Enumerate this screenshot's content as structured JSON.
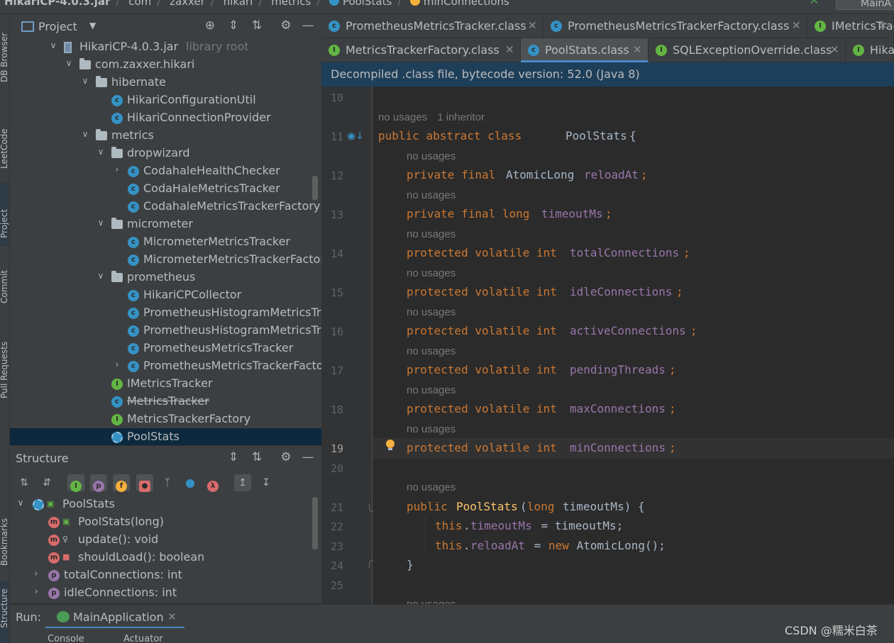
{
  "breadcrumb": [
    "HikariCP-4.0.3.jar",
    "com",
    "zaxxer",
    "hikari",
    "metrics",
    "PoolStats",
    "minConnections"
  ],
  "run_config": "MainA",
  "left_stripe": [
    "DB Browser",
    "LeetCode",
    "Project",
    "Commit",
    "Pull Requests",
    "Bookmarks",
    "Structure"
  ],
  "project": {
    "title": "Project",
    "tree": [
      {
        "label": "HikariCP-4.0.3.jar",
        "muted": "library root",
        "depth": 0,
        "arrow": "down",
        "icon": "jar"
      },
      {
        "label": "com.zaxxer.hikari",
        "depth": 1,
        "arrow": "down",
        "icon": "folder"
      },
      {
        "label": "hibernate",
        "depth": 2,
        "arrow": "down",
        "icon": "folder"
      },
      {
        "label": "HikariConfigurationUtil",
        "depth": 3,
        "arrow": "",
        "icon": "class"
      },
      {
        "label": "HikariConnectionProvider",
        "depth": 3,
        "arrow": "",
        "icon": "class"
      },
      {
        "label": "metrics",
        "depth": 2,
        "arrow": "down",
        "icon": "folder"
      },
      {
        "label": "dropwizard",
        "depth": 3,
        "arrow": "down",
        "icon": "folder"
      },
      {
        "label": "CodahaleHealthChecker",
        "depth": 4,
        "arrow": "right",
        "icon": "class"
      },
      {
        "label": "CodaHaleMetricsTracker",
        "depth": 4,
        "arrow": "",
        "icon": "class"
      },
      {
        "label": "CodahaleMetricsTrackerFactory",
        "depth": 4,
        "arrow": "",
        "icon": "class"
      },
      {
        "label": "micrometer",
        "depth": 3,
        "arrow": "down",
        "icon": "folder"
      },
      {
        "label": "MicrometerMetricsTracker",
        "depth": 4,
        "arrow": "",
        "icon": "class"
      },
      {
        "label": "MicrometerMetricsTrackerFactor",
        "depth": 4,
        "arrow": "",
        "icon": "class"
      },
      {
        "label": "prometheus",
        "depth": 3,
        "arrow": "down",
        "icon": "folder"
      },
      {
        "label": "HikariCPCollector",
        "depth": 4,
        "arrow": "",
        "icon": "class"
      },
      {
        "label": "PrometheusHistogramMetricsTra",
        "depth": 4,
        "arrow": "",
        "icon": "class"
      },
      {
        "label": "PrometheusHistogramMetricsTra",
        "depth": 4,
        "arrow": "",
        "icon": "class"
      },
      {
        "label": "PrometheusMetricsTracker",
        "depth": 4,
        "arrow": "",
        "icon": "class"
      },
      {
        "label": "PrometheusMetricsTrackerFacto",
        "depth": 4,
        "arrow": "right",
        "icon": "class"
      },
      {
        "label": "IMetricsTracker",
        "depth": 3,
        "arrow": "",
        "icon": "interface"
      },
      {
        "label": "MetricsTracker",
        "depth": 3,
        "arrow": "",
        "icon": "class",
        "strike": true
      },
      {
        "label": "MetricsTrackerFactory",
        "depth": 3,
        "arrow": "",
        "icon": "interface"
      },
      {
        "label": "PoolStats",
        "depth": 3,
        "arrow": "",
        "icon": "abstract",
        "selected": true
      }
    ]
  },
  "structure": {
    "title": "Structure",
    "items": [
      {
        "label": "PoolStats",
        "depth": 0,
        "arrow": "down",
        "icon": "c"
      },
      {
        "label": "PoolStats(long)",
        "depth": 1,
        "arrow": "",
        "icon": "m",
        "vis": "public"
      },
      {
        "label": "update(): void",
        "depth": 1,
        "arrow": "",
        "icon": "m",
        "vis": "package"
      },
      {
        "label": "shouldLoad(): boolean",
        "depth": 1,
        "arrow": "",
        "icon": "m",
        "vis": "private"
      },
      {
        "label": "totalConnections: int",
        "depth": 1,
        "arrow": "right",
        "icon": "p"
      },
      {
        "label": "idleConnections: int",
        "depth": 1,
        "arrow": "right",
        "icon": "p"
      }
    ]
  },
  "tabs": {
    "row1": [
      {
        "label": "PrometheusMetricsTracker.class",
        "icon": "class"
      },
      {
        "label": "PrometheusMetricsTrackerFactory.class",
        "icon": "class"
      },
      {
        "label": "IMetricsTrac",
        "icon": "interface"
      }
    ],
    "row2": [
      {
        "label": "MetricsTrackerFactory.class",
        "icon": "interface"
      },
      {
        "label": "PoolStats.class",
        "icon": "abstract",
        "active": true
      },
      {
        "label": "SQLExceptionOverride.class",
        "icon": "interface"
      },
      {
        "label": "Hika",
        "icon": "interface"
      }
    ]
  },
  "banner": "Decompiled .class file, bytecode version: 52.0 (Java 8)",
  "hints": {
    "no_usages": "no usages",
    "inheritor": "1 inheritor"
  },
  "code": {
    "l10": "10",
    "l11": {
      "n": "11",
      "kw": "public abstract class",
      "name": "PoolStats",
      "rest": "{"
    },
    "fields": [
      {
        "n": "12",
        "mods": "private final",
        "type": "AtomicLong",
        "name": "reloadAt"
      },
      {
        "n": "13",
        "mods": "private final long",
        "type": "",
        "name": "timeoutMs"
      },
      {
        "n": "14",
        "mods": "protected volatile int",
        "type": "",
        "name": "totalConnections"
      },
      {
        "n": "15",
        "mods": "protected volatile int",
        "type": "",
        "name": "idleConnections"
      },
      {
        "n": "16",
        "mods": "protected volatile int",
        "type": "",
        "name": "activeConnections"
      },
      {
        "n": "17",
        "mods": "protected volatile int",
        "type": "",
        "name": "pendingThreads"
      },
      {
        "n": "18",
        "mods": "protected volatile int",
        "type": "",
        "name": "maxConnections"
      },
      {
        "n": "19",
        "mods": "protected volatile int",
        "type": "",
        "name": "minConnections"
      }
    ],
    "l20": "20",
    "l21": {
      "n": "21",
      "kw": "public",
      "name": "PoolStats",
      "args_kw": "long",
      "args": "timeoutMs) {"
    },
    "l22": {
      "n": "22",
      "this": "this",
      "field": "timeoutMs",
      "rest": " = timeoutMs;"
    },
    "l23": {
      "n": "23",
      "this": "this",
      "field": "reloadAt",
      "new": "new",
      "rest": " AtomicLong();"
    },
    "l24": {
      "n": "24",
      "text": "}"
    },
    "l25": "25"
  },
  "run": {
    "label": "Run:",
    "tab": "MainApplication"
  },
  "bottom_tabs": [
    "Console",
    "Actuator"
  ],
  "watermark": "CSDN @糯米白茶"
}
